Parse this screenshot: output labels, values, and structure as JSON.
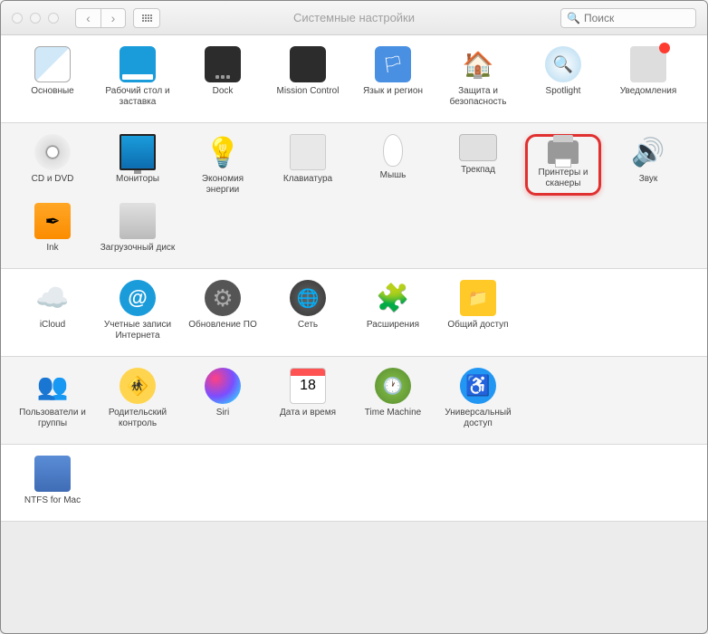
{
  "window": {
    "title": "Системные настройки"
  },
  "search": {
    "placeholder": "Поиск"
  },
  "sections": [
    {
      "alt": false,
      "items": [
        {
          "id": "general",
          "label": "Основные",
          "iconClass": "ic-general"
        },
        {
          "id": "desktop",
          "label": "Рабочий стол и заставка",
          "iconClass": "ic-desktop"
        },
        {
          "id": "dock",
          "label": "Dock",
          "iconClass": "ic-dock",
          "dots": 3
        },
        {
          "id": "mission",
          "label": "Mission Control",
          "iconClass": "ic-mission",
          "grid": 4
        },
        {
          "id": "lang",
          "label": "Язык и регион",
          "iconClass": "ic-lang",
          "glyph": "🏳"
        },
        {
          "id": "security",
          "label": "Защита и безопасность",
          "iconClass": "ic-security",
          "glyph": "🏠"
        },
        {
          "id": "spotlight",
          "label": "Spotlight",
          "iconClass": "ic-spotlight"
        },
        {
          "id": "notifications",
          "label": "Уведомления",
          "iconClass": "ic-notif",
          "badge": true
        }
      ]
    },
    {
      "alt": true,
      "items": [
        {
          "id": "cddvd",
          "label": "CD и DVD",
          "iconClass": "ic-cd"
        },
        {
          "id": "displays",
          "label": "Мониторы",
          "iconClass": "ic-display"
        },
        {
          "id": "energy",
          "label": "Экономия энергии",
          "iconClass": "ic-energy",
          "glyph": "💡"
        },
        {
          "id": "keyboard",
          "label": "Клавиатура",
          "iconClass": "ic-keyboard"
        },
        {
          "id": "mouse",
          "label": "Мышь",
          "iconClass": "ic-mouse"
        },
        {
          "id": "trackpad",
          "label": "Трекпад",
          "iconClass": "ic-trackpad"
        },
        {
          "id": "printers",
          "label": "Принтеры и сканеры",
          "iconClass": "ic-printer",
          "highlight": true
        },
        {
          "id": "sound",
          "label": "Звук",
          "iconClass": "ic-sound",
          "glyph": "🔊"
        },
        {
          "id": "ink",
          "label": "Ink",
          "iconClass": "ic-ink",
          "glyph": "✒"
        },
        {
          "id": "startup",
          "label": "Загрузочный диск",
          "iconClass": "ic-startup"
        }
      ]
    },
    {
      "alt": false,
      "items": [
        {
          "id": "icloud",
          "label": "iCloud",
          "iconClass": "ic-icloud",
          "glyph": "☁️"
        },
        {
          "id": "accounts",
          "label": "Учетные записи Интернета",
          "iconClass": "ic-accounts",
          "glyph": "@"
        },
        {
          "id": "update",
          "label": "Обновление ПО",
          "iconClass": "ic-update",
          "glyph": "⚙"
        },
        {
          "id": "network",
          "label": "Сеть",
          "iconClass": "ic-network",
          "glyph": "🌐"
        },
        {
          "id": "extensions",
          "label": "Расширения",
          "iconClass": "ic-ext",
          "glyph": "🧩"
        },
        {
          "id": "sharing",
          "label": "Общий доступ",
          "iconClass": "ic-sharing",
          "glyph": "📁"
        }
      ]
    },
    {
      "alt": true,
      "items": [
        {
          "id": "users",
          "label": "Пользователи и группы",
          "iconClass": "ic-users",
          "glyph": "👥"
        },
        {
          "id": "parental",
          "label": "Родительский контроль",
          "iconClass": "ic-parental",
          "glyph": "🚸"
        },
        {
          "id": "siri",
          "label": "Siri",
          "iconClass": "ic-siri"
        },
        {
          "id": "datetime",
          "label": "Дата и время",
          "iconClass": "ic-date",
          "glyph": "18"
        },
        {
          "id": "timemachine",
          "label": "Time Machine",
          "iconClass": "ic-tm",
          "glyph": "🕐"
        },
        {
          "id": "accessibility",
          "label": "Универсальный доступ",
          "iconClass": "ic-access",
          "glyph": "♿"
        }
      ]
    },
    {
      "alt": false,
      "items": [
        {
          "id": "ntfs",
          "label": "NTFS for Mac",
          "iconClass": "ic-ntfs",
          "grid": 4
        }
      ]
    }
  ]
}
